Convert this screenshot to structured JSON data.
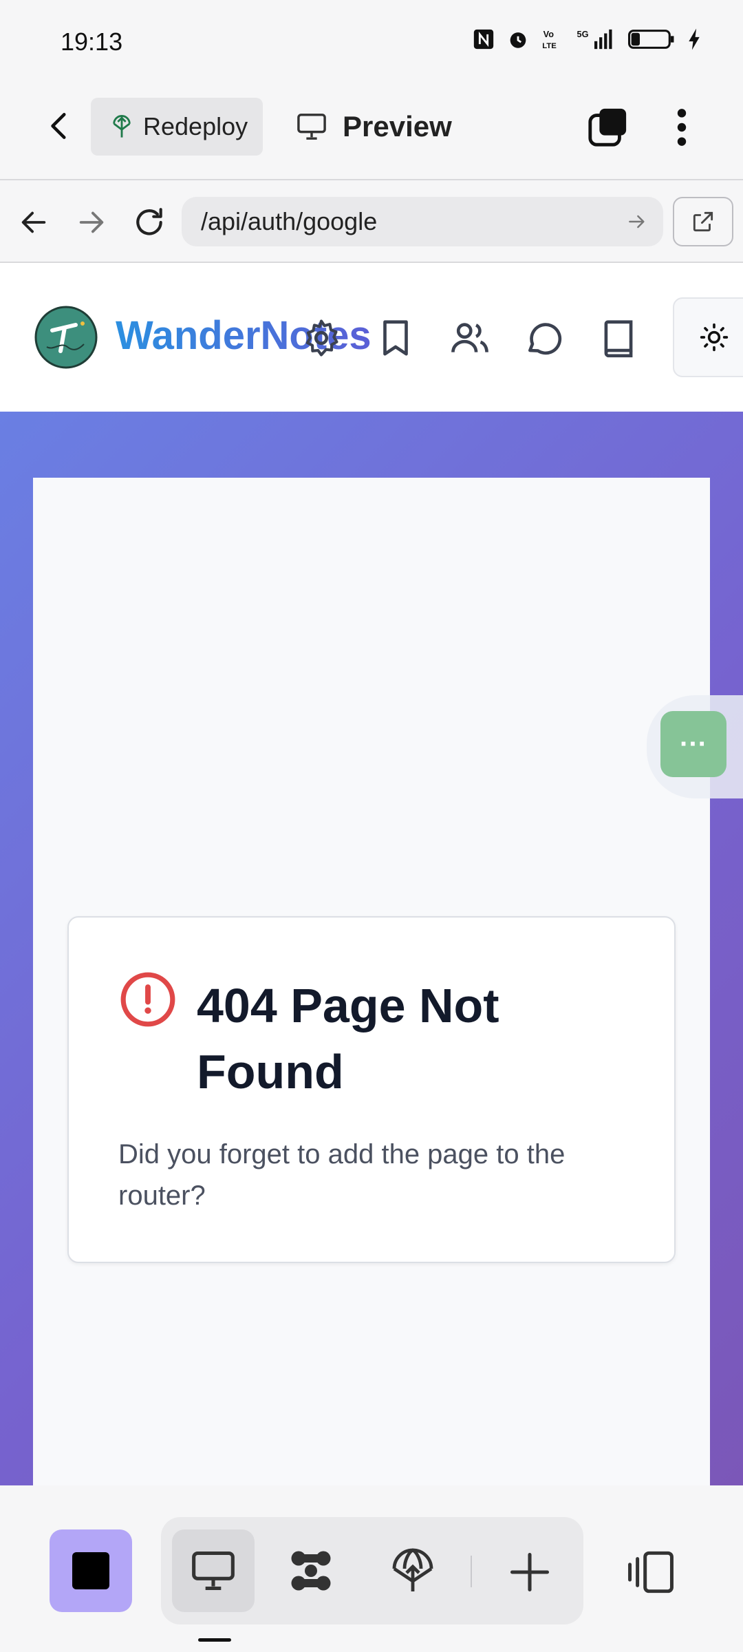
{
  "status_bar": {
    "time": "19:13",
    "battery": "3"
  },
  "app_bar": {
    "redeploy_label": "Redeploy",
    "preview_label": "Preview"
  },
  "url_bar": {
    "url": "/api/auth/google"
  },
  "site": {
    "brand": "WanderNotes"
  },
  "error_card": {
    "title": "404 Page Not Found",
    "message": "Did you forget to add the page to the router?"
  },
  "floating_button": {
    "label": "···"
  },
  "colors": {
    "accent": "#5b5fd6",
    "stop_button": "#b3a6f7",
    "error": "#e04848"
  }
}
